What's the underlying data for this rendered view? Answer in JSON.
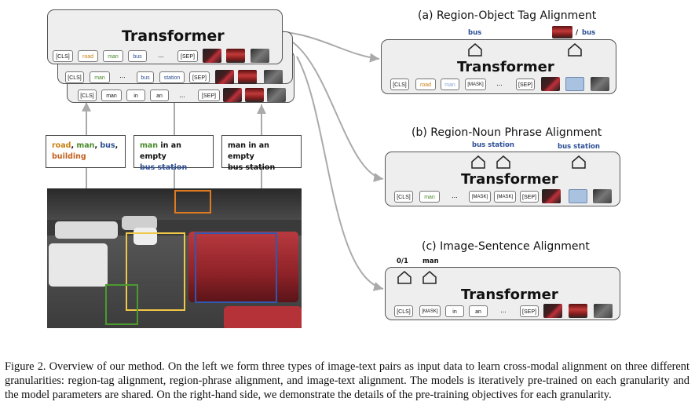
{
  "left": {
    "encoders": [
      {
        "title": "Transformer",
        "tokens": [
          "[CLS]",
          "road",
          "man",
          "bus",
          "...",
          "[SEP]"
        ]
      },
      {
        "tokens": [
          "[CLS]",
          "man",
          "...",
          "bus",
          "station",
          "[SEP]"
        ]
      },
      {
        "tokens": [
          "[CLS]",
          "man",
          "in",
          "an",
          "...",
          "[SEP]"
        ]
      }
    ],
    "inputs": {
      "tags": {
        "road": "road",
        "man": "man",
        "bus": "bus",
        "building": "building",
        "sep": ", ",
        "sep_end": ","
      },
      "phrase": {
        "man": "man",
        "rest": " in an empty",
        "bus_station": "bus station"
      },
      "sentence": {
        "line1": "man in an empty",
        "line2": "bus station"
      }
    }
  },
  "right": {
    "a": {
      "title": "(a) Region-Object Tag Alignment",
      "pred1": "bus",
      "pred2_sep": "/ ",
      "pred2": "bus",
      "model": "Transformer",
      "tokens": [
        "[CLS]",
        "road",
        "man",
        "[MASK]",
        "...",
        "[SEP]"
      ]
    },
    "b": {
      "title": "(b) Region-Noun Phrase Alignment",
      "pred1": "bus station",
      "pred2": "bus station",
      "model": "Transformer",
      "tokens": [
        "[CLS]",
        "man",
        "...",
        "[MASK]",
        "[MASK]",
        "[SEP]"
      ]
    },
    "c": {
      "title": "(c) Image-Sentence Alignment",
      "pred1": "0/1",
      "pred2": "man",
      "model": "Transformer",
      "tokens": [
        "[CLS]",
        "[MASK]",
        "in",
        "an",
        "...",
        "[SEP]"
      ]
    }
  },
  "caption": "Figure 2. Overview of our method. On the left we form three types of image-text pairs as input data to learn cross-modal alignment on three different granularities: region-tag alignment, region-phrase alignment, and image-text alignment. The models is iteratively pre-trained on each granularity and the model parameters are shared. On the right-hand side, we demonstrate the details of the pre-training objectives for each granularity.",
  "colors": {
    "tag_orange": "#c87f10",
    "tag_green": "#4a8a2a",
    "tag_blue": "#2b4e95",
    "tag_brown": "#c2601e",
    "arrow": "#aaaaaa"
  }
}
